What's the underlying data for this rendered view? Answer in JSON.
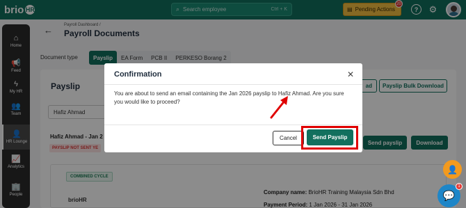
{
  "app": {
    "logo_text": "brio",
    "logo_suffix": "HR"
  },
  "topbar": {
    "search_placeholder": "Search employee",
    "search_shortcut": "Ctrl + K",
    "pending_label": "Pending Actions",
    "pending_count": "20"
  },
  "sidebar": {
    "items": [
      {
        "label": "Home",
        "icon": "home-icon",
        "glyph": "⌂"
      },
      {
        "label": "Feed",
        "icon": "megaphone-icon",
        "glyph": "📢"
      },
      {
        "label": "My HR",
        "icon": "bolt-icon",
        "glyph": "ϟ"
      },
      {
        "label": "Team",
        "icon": "team-icon",
        "glyph": "👥"
      },
      {
        "label": "HR Lounge",
        "icon": "hr-lounge-icon",
        "glyph": "👤"
      },
      {
        "label": "Analytics",
        "icon": "analytics-icon",
        "glyph": "📈"
      },
      {
        "label": "People",
        "icon": "people-icon",
        "glyph": "🏢"
      }
    ]
  },
  "header": {
    "breadcrumb": "Payroll Dashboard /",
    "title": "Payroll Documents"
  },
  "document_type": {
    "label": "Document type",
    "tabs": [
      "Payslip",
      "EA Form",
      "PCB II",
      "PERKESO Borang 2"
    ],
    "active": "Payslip"
  },
  "card": {
    "title": "Payslip",
    "download_btn_partial": "ad",
    "bulk_download": "Payslip Bulk Download",
    "employee_value": "Hafiz Ahmad",
    "employee_row_name": "Hafiz Ahmad - Jan 2",
    "status_badge": "PAYSLIP NOT SENT YE",
    "send_payslip": "Send payslip",
    "download": "Download",
    "cycle_badge": "COMBINED CYCLE",
    "mini_logo": "brioHR",
    "company_label": "Company name:",
    "company_value": "BrioHR Training Malaysia Sdn Bhd",
    "period_label": "Payment Period:",
    "period_value": "1 Jan 2026 - 31 Jan 2026"
  },
  "modal": {
    "title": "Confirmation",
    "message": "You are about to send an email containing the Jan 2026 payslip to Hafiz Ahmad. Are you sure you would like to proceed?",
    "cancel": "Cancel",
    "confirm": "Send Payslip"
  },
  "floating": {
    "chat_badge": "1"
  },
  "colors": {
    "brand": "#12705e",
    "pending": "#f4c043",
    "highlight": "#e00000"
  }
}
